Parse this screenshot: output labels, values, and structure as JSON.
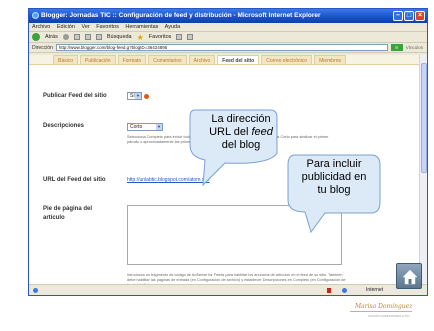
{
  "window": {
    "title": "Blogger: Jornadas TIC :: Configuración de feed y distribución - Microsoft Internet Explorer",
    "menu": [
      "Archivo",
      "Edición",
      "Ver",
      "Favoritos",
      "Herramientas",
      "Ayuda"
    ],
    "toolbar": {
      "back": "Atrás",
      "search": "Búsqueda",
      "favorites": "Favoritos"
    },
    "address_label": "Dirección",
    "address": "http://www.blogger.com/blog-feed.g?blogID=36424895",
    "go": "Ir",
    "links": "Vínculos"
  },
  "tabs": [
    {
      "label": "Básico",
      "active": false
    },
    {
      "label": "Publicación",
      "active": false
    },
    {
      "label": "Formato",
      "active": false
    },
    {
      "label": "Comentarios",
      "active": false
    },
    {
      "label": "Archivo",
      "active": false
    },
    {
      "label": "Feed del sitio",
      "active": true
    },
    {
      "label": "Correo electrónico",
      "active": false
    },
    {
      "label": "Miembros",
      "active": false
    }
  ],
  "form": {
    "publish_label": "Publicar Feed del sitio",
    "publish_value": "Sí",
    "descriptions_label": "Descripciones",
    "descriptions_value": "Corto",
    "descriptions_help": "Selecciona Completo para incluir todo el contenido de cada entrada en el feed. Selecciona Corto para sindicar el primer párrafo o aproximadamente las primeras 255 letras de cada entrada.",
    "feed_url_label": "URL del Feed del sitio",
    "feed_url": "http://unlabtic.blogspot.com/atom.xml",
    "footer_label": "Pie de página del artículo",
    "footer_help": "Introduzca un fragmento de código de AdSense for Feeds para habilitar los anuncios de artículos en el feed de su sitio. También debe habilitar las páginas de entrada (en Configuración de archivo) y establecer Descripciones en Completo (en Configuración de feed del sitio)."
  },
  "status": {
    "zone": "Internet"
  },
  "callouts": {
    "feed_url": {
      "line1": "La dirección",
      "line2": "URL del ",
      "em": "feed",
      "line3": "del blog"
    },
    "ads": {
      "line1": "Para incluir",
      "line2": "publicidad en",
      "line3": "tu blog"
    }
  },
  "signature": {
    "name": "Marisa Domínguez",
    "subtitle": "ACCIÓN COMUNITARIA & TIC"
  }
}
